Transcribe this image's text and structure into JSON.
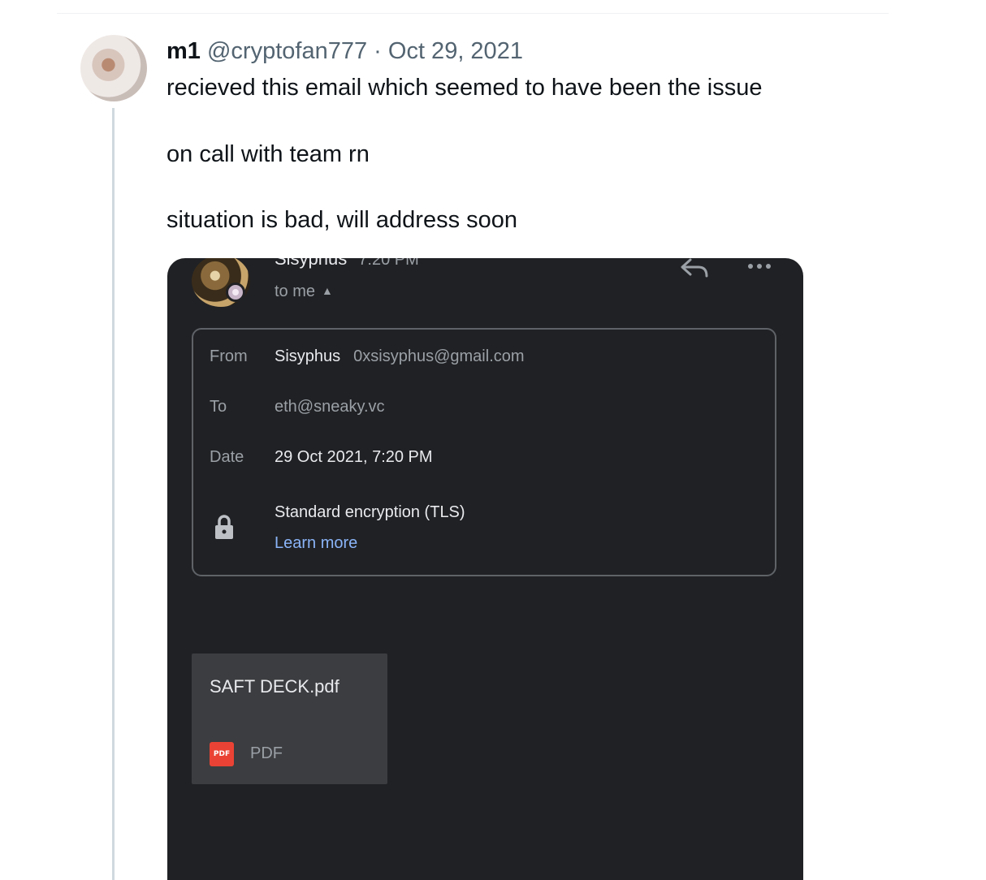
{
  "tweet": {
    "display_name": "m1",
    "handle": "@cryptofan777",
    "separator": "·",
    "date": "Oct 29, 2021",
    "lines": [
      "recieved this email which seemed to have been the issue",
      "on call with team rn",
      "situation is bad, will address soon"
    ]
  },
  "email": {
    "sender_name": "Sisyphus",
    "sender_time": "7:20 PM",
    "recipient_summary": "to me",
    "details": {
      "from_label": "From",
      "from_name": "Sisyphus",
      "from_email": "0xsisyphus@gmail.com",
      "to_label": "To",
      "to_value": "eth@sneaky.vc",
      "date_label": "Date",
      "date_value": "29 Oct 2021, 7:20 PM",
      "security_text": "Standard encryption (TLS)",
      "learn_more": "Learn more"
    },
    "attachment": {
      "name": "SAFT DECK.pdf",
      "icon_text": "PDF",
      "type": "PDF"
    },
    "icons": [
      "reply-icon",
      "more-icon",
      "lock-icon",
      "pdf-icon",
      "chevron-up-icon"
    ]
  },
  "colors": {
    "email_bg": "#202124",
    "link": "#8ab4f8",
    "pdf_red": "#ea4335",
    "attachment_bg": "#3c3d40"
  }
}
